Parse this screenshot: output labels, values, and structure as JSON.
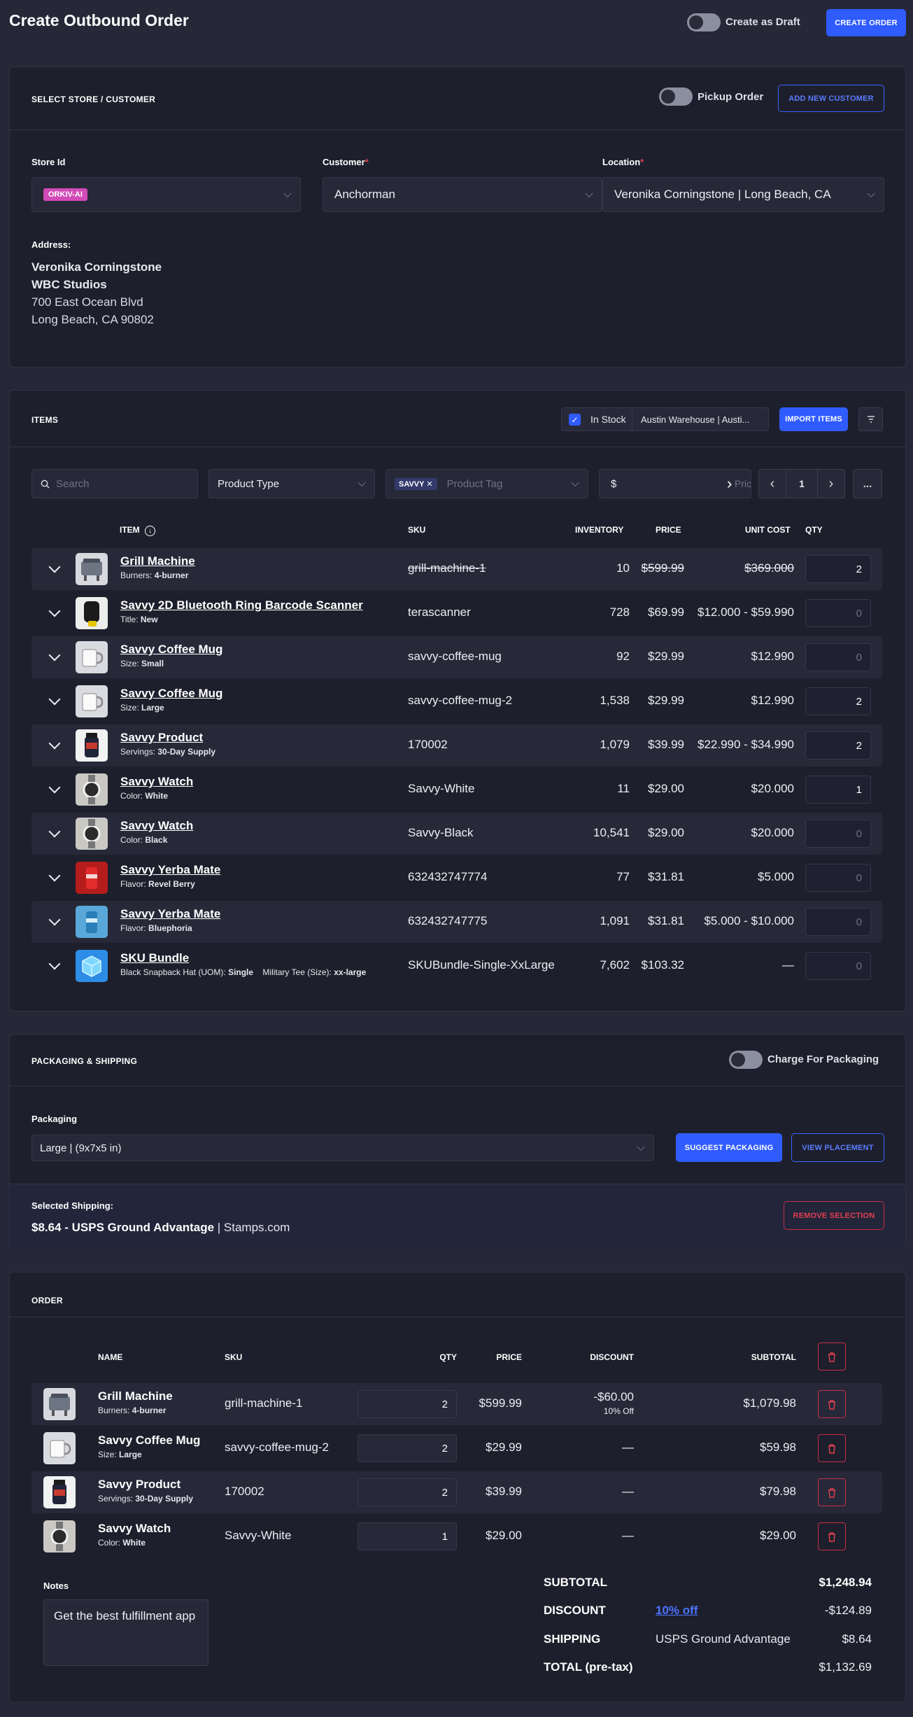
{
  "header": {
    "title": "Create Outbound Order",
    "draft_label": "Create as Draft",
    "create_label": "CREATE ORDER"
  },
  "store": {
    "section_title": "SELECT STORE / CUSTOMER",
    "pickup_label": "Pickup Order",
    "add_customer_label": "ADD NEW CUSTOMER",
    "store_label": "Store Id",
    "store_value": "ORKIV-AI",
    "customer_label": "Customer",
    "customer_value": "Anchorman",
    "location_label": "Location",
    "location_value": "Veronika Corningstone | Long Beach, CA",
    "address_label": "Address:",
    "address": [
      "Veronika Corningstone",
      "WBC Studios",
      "700 East Ocean Blvd",
      "Long Beach, CA 90802"
    ]
  },
  "items": {
    "section_title": "ITEMS",
    "in_stock_label": "In Stock",
    "warehouse": "Austin Warehouse | Austi...",
    "import_label": "IMPORT ITEMS",
    "search_placeholder": "Search",
    "product_type_placeholder": "Product Type",
    "tag_chip": "SAVVY",
    "tag_placeholder": "Product Tag",
    "price_symbol": "$",
    "price_placeholder": "Pric",
    "page": "1",
    "more": "...",
    "columns": {
      "item": "ITEM",
      "sku": "SKU",
      "inventory": "INVENTORY",
      "price": "PRICE",
      "unit_cost": "UNIT COST",
      "qty": "QTY"
    },
    "rows": [
      {
        "name": "Grill Machine",
        "attr_label": "Burners:",
        "attr_value": "4-burner",
        "sku": "grill-machine-1",
        "inventory": "10",
        "price": "$599.99",
        "cost": "$369.000",
        "qty": "2",
        "thumb": "grill-icon"
      },
      {
        "name": "Savvy 2D Bluetooth Ring Barcode Scanner",
        "attr_label": "Title:",
        "attr_value": "New",
        "sku": "terascanner",
        "inventory": "728",
        "price": "$69.99",
        "cost": "$12.000 - $59.990",
        "qty": "0",
        "thumb": "scanner-icon"
      },
      {
        "name": "Savvy Coffee Mug",
        "attr_label": "Size:",
        "attr_value": "Small",
        "sku": "savvy-coffee-mug",
        "inventory": "92",
        "price": "$29.99",
        "cost": "$12.990",
        "qty": "0",
        "thumb": "mug-icon"
      },
      {
        "name": "Savvy Coffee Mug",
        "attr_label": "Size:",
        "attr_value": "Large",
        "sku": "savvy-coffee-mug-2",
        "inventory": "1,538",
        "price": "$29.99",
        "cost": "$12.990",
        "qty": "2",
        "thumb": "mug-icon"
      },
      {
        "name": "Savvy Product",
        "attr_label": "Servings:",
        "attr_value": "30-Day Supply",
        "sku": "170002",
        "inventory": "1,079",
        "price": "$39.99",
        "cost": "$22.990 - $34.990",
        "qty": "2",
        "thumb": "bottle-icon"
      },
      {
        "name": "Savvy Watch",
        "attr_label": "Color:",
        "attr_value": "White",
        "sku": "Savvy-White",
        "inventory": "11",
        "price": "$29.00",
        "cost": "$20.000",
        "qty": "1",
        "thumb": "watch-icon"
      },
      {
        "name": "Savvy Watch",
        "attr_label": "Color:",
        "attr_value": "Black",
        "sku": "Savvy-Black",
        "inventory": "10,541",
        "price": "$29.00",
        "cost": "$20.000",
        "qty": "0",
        "thumb": "watch-icon"
      },
      {
        "name": "Savvy Yerba Mate",
        "attr_label": "Flavor:",
        "attr_value": "Revel Berry",
        "sku": "632432747774",
        "inventory": "77",
        "price": "$31.81",
        "cost": "$5.000",
        "qty": "0",
        "thumb": "can-red-icon"
      },
      {
        "name": "Savvy Yerba Mate",
        "attr_label": "Flavor:",
        "attr_value": "Bluephoria",
        "sku": "632432747775",
        "inventory": "1,091",
        "price": "$31.81",
        "cost": "$5.000 - $10.000",
        "qty": "0",
        "thumb": "can-blue-icon"
      },
      {
        "name": "SKU Bundle",
        "attr_label": "Black Snapback Hat (UOM):",
        "attr_value": "Single",
        "attr2_label": "Military Tee (Size):",
        "attr2_value": "xx-large",
        "sku": "SKUBundle-Single-XxLarge",
        "inventory": "7,602",
        "price": "$103.32",
        "cost": "—",
        "qty": "0",
        "thumb": "bundle-icon"
      }
    ]
  },
  "packaging": {
    "section_title": "PACKAGING & SHIPPING",
    "charge_label": "Charge For Packaging",
    "packaging_label": "Packaging",
    "packaging_value": "Large | (9x7x5 in)",
    "suggest_label": "SUGGEST PACKAGING",
    "view_label": "VIEW PLACEMENT",
    "selected_label": "Selected Shipping:",
    "selected_rate": "$8.64 - USPS Ground Advantage",
    "selected_carrier": " | Stamps.com",
    "remove_label": "REMOVE SELECTION"
  },
  "order": {
    "section_title": "ORDER",
    "columns": {
      "name": "NAME",
      "sku": "SKU",
      "qty": "QTY",
      "price": "PRICE",
      "discount": "DISCOUNT",
      "subtotal": "SUBTOTAL"
    },
    "rows": [
      {
        "name": "Grill Machine",
        "attr_label": "Burners:",
        "attr_value": "4-burner",
        "sku": "grill-machine-1",
        "qty": "2",
        "price": "$599.99",
        "discount": "-$60.00",
        "discount_note": "10% Off",
        "subtotal": "$1,079.98",
        "thumb": "grill-icon"
      },
      {
        "name": "Savvy Coffee Mug",
        "attr_label": "Size:",
        "attr_value": "Large",
        "sku": "savvy-coffee-mug-2",
        "qty": "2",
        "price": "$29.99",
        "discount": "—",
        "discount_note": "",
        "subtotal": "$59.98",
        "thumb": "mug-icon"
      },
      {
        "name": "Savvy Product",
        "attr_label": "Servings:",
        "attr_value": "30-Day Supply",
        "sku": "170002",
        "qty": "2",
        "price": "$39.99",
        "discount": "—",
        "discount_note": "",
        "subtotal": "$79.98",
        "thumb": "bottle-icon"
      },
      {
        "name": "Savvy Watch",
        "attr_label": "Color:",
        "attr_value": "White",
        "sku": "Savvy-White",
        "qty": "1",
        "price": "$29.00",
        "discount": "—",
        "discount_note": "",
        "subtotal": "$29.00",
        "thumb": "watch-icon"
      }
    ],
    "notes_label": "Notes",
    "notes_value": "Get the best fulfillment app",
    "totals": {
      "subtotal_label": "SUBTOTAL",
      "subtotal_value": "$1,248.94",
      "discount_label": "DISCOUNT",
      "discount_link": "10% off",
      "discount_value": "-$124.89",
      "shipping_label": "SHIPPING",
      "shipping_method": "USPS Ground Advantage",
      "shipping_value": "$8.64",
      "total_label": "TOTAL (pre-tax)",
      "total_value": "$1,132.69"
    }
  },
  "colors": {
    "accent": "#2f5bff",
    "danger": "#c53045",
    "bg": "#262837",
    "card": "#1e1f2c",
    "tag": "#d14ab7"
  }
}
